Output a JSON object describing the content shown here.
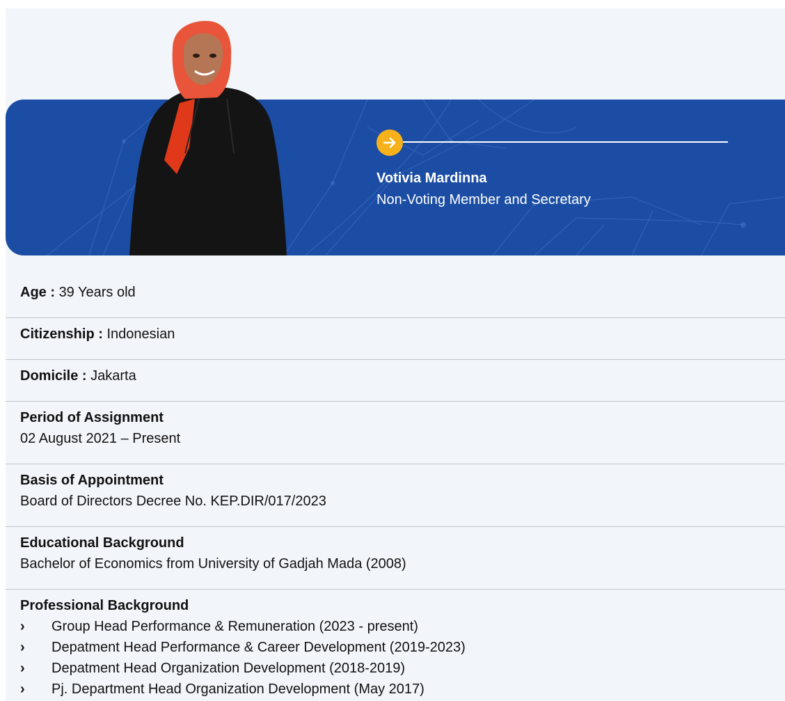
{
  "profile": {
    "name": "Votivia Mardinna",
    "role": "Non-Voting Member and Secretary"
  },
  "colors": {
    "banner": "#1b4da4",
    "accent": "#f7b21b",
    "background": "#f2f5fa"
  },
  "icons": {
    "next": "arrow-right-icon",
    "bullet": "chevron-right-icon"
  },
  "details": {
    "age": {
      "label": "Age :",
      "value": "39 Years old"
    },
    "citizenship": {
      "label": "Citizenship :",
      "value": "Indonesian"
    },
    "domicile": {
      "label": "Domicile :",
      "value": "Jakarta"
    },
    "period": {
      "label": "Period of Assignment",
      "value": "02 August 2021 – Present"
    },
    "basis": {
      "label": "Basis of Appointment",
      "value": "Board of Directors Decree No. KEP.DIR/017/2023"
    },
    "education": {
      "label": "Educational Background",
      "value": "Bachelor of Economics from University of Gadjah Mada (2008)"
    },
    "professional": {
      "label": "Professional Background",
      "bullet": "›",
      "items": [
        "Group Head Performance & Remuneration (2023 - present)",
        "Depatment Head Performance & Career Development (2019-2023)",
        "Depatment Head Organization Development (2018-2019)",
        "Pj. Department Head Organization Development (May 2017)"
      ]
    }
  }
}
